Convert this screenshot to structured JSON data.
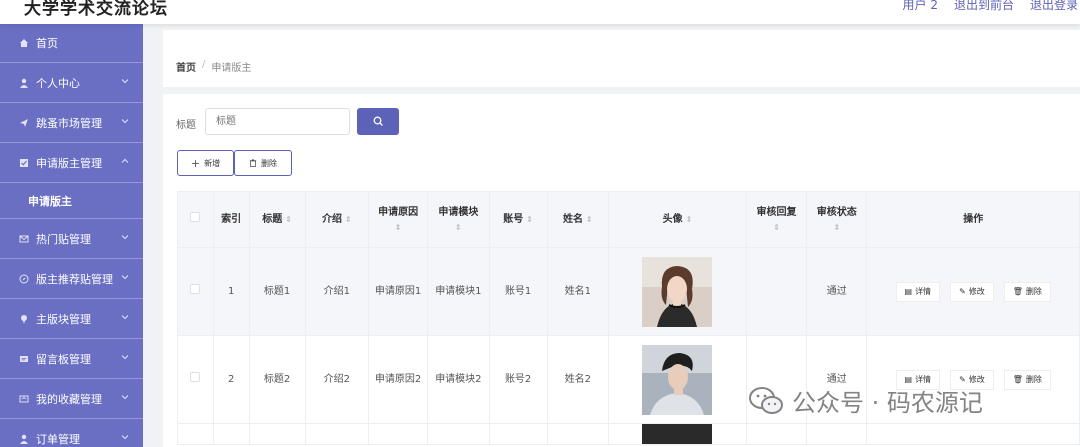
{
  "app": {
    "title": "大学学术交流论坛",
    "user_link": "用户 2",
    "back_link": "退出到前台",
    "logout_link": "退出登录"
  },
  "sidebar": {
    "items": [
      {
        "label": "首页",
        "icon": "home-icon"
      },
      {
        "label": "个人中心",
        "icon": "user-icon"
      },
      {
        "label": "跳蚤市场管理",
        "icon": "send-icon"
      },
      {
        "label": "申请版主管理",
        "icon": "checkbox-icon"
      },
      {
        "label": "申请版主",
        "icon": ""
      },
      {
        "label": "热门贴管理",
        "icon": "mail-icon"
      },
      {
        "label": "版主推荐贴管理",
        "icon": "compass-icon"
      },
      {
        "label": "主版块管理",
        "icon": "pin-icon"
      },
      {
        "label": "留言板管理",
        "icon": "message-icon"
      },
      {
        "label": "我的收藏管理",
        "icon": "star-icon"
      },
      {
        "label": "订单管理",
        "icon": "user-icon"
      }
    ]
  },
  "breadcrumb": {
    "home": "首页",
    "separator": "/",
    "current": "申请版主"
  },
  "search": {
    "label": "标题",
    "placeholder": "标题"
  },
  "actions": {
    "add_label": "新增",
    "delete_label": "删除"
  },
  "table": {
    "headers": {
      "index": "索引",
      "title": "标题",
      "intro": "介绍",
      "reason": "申请原因",
      "module": "申请模块",
      "account": "账号",
      "name": "姓名",
      "avatar": "头像",
      "reply": "审核回复",
      "status": "审核状态",
      "ops": "操作"
    },
    "rows": [
      {
        "index": "1",
        "title": "标题1",
        "intro": "介绍1",
        "reason": "申请原因1",
        "module": "申请模块1",
        "account": "账号1",
        "name": "姓名1",
        "reply": "",
        "status": "通过"
      },
      {
        "index": "2",
        "title": "标题2",
        "intro": "介绍2",
        "reason": "申请原因2",
        "module": "申请模块2",
        "account": "账号2",
        "name": "姓名2",
        "reply": "",
        "status": "通过"
      }
    ],
    "op_labels": {
      "detail": "详情",
      "edit": "修改",
      "delete": "删除"
    }
  },
  "watermark": {
    "text": "公众号 · 码农源记"
  },
  "colors": {
    "accent": "#5b62b8",
    "sidebar": "#6a6fc4"
  }
}
